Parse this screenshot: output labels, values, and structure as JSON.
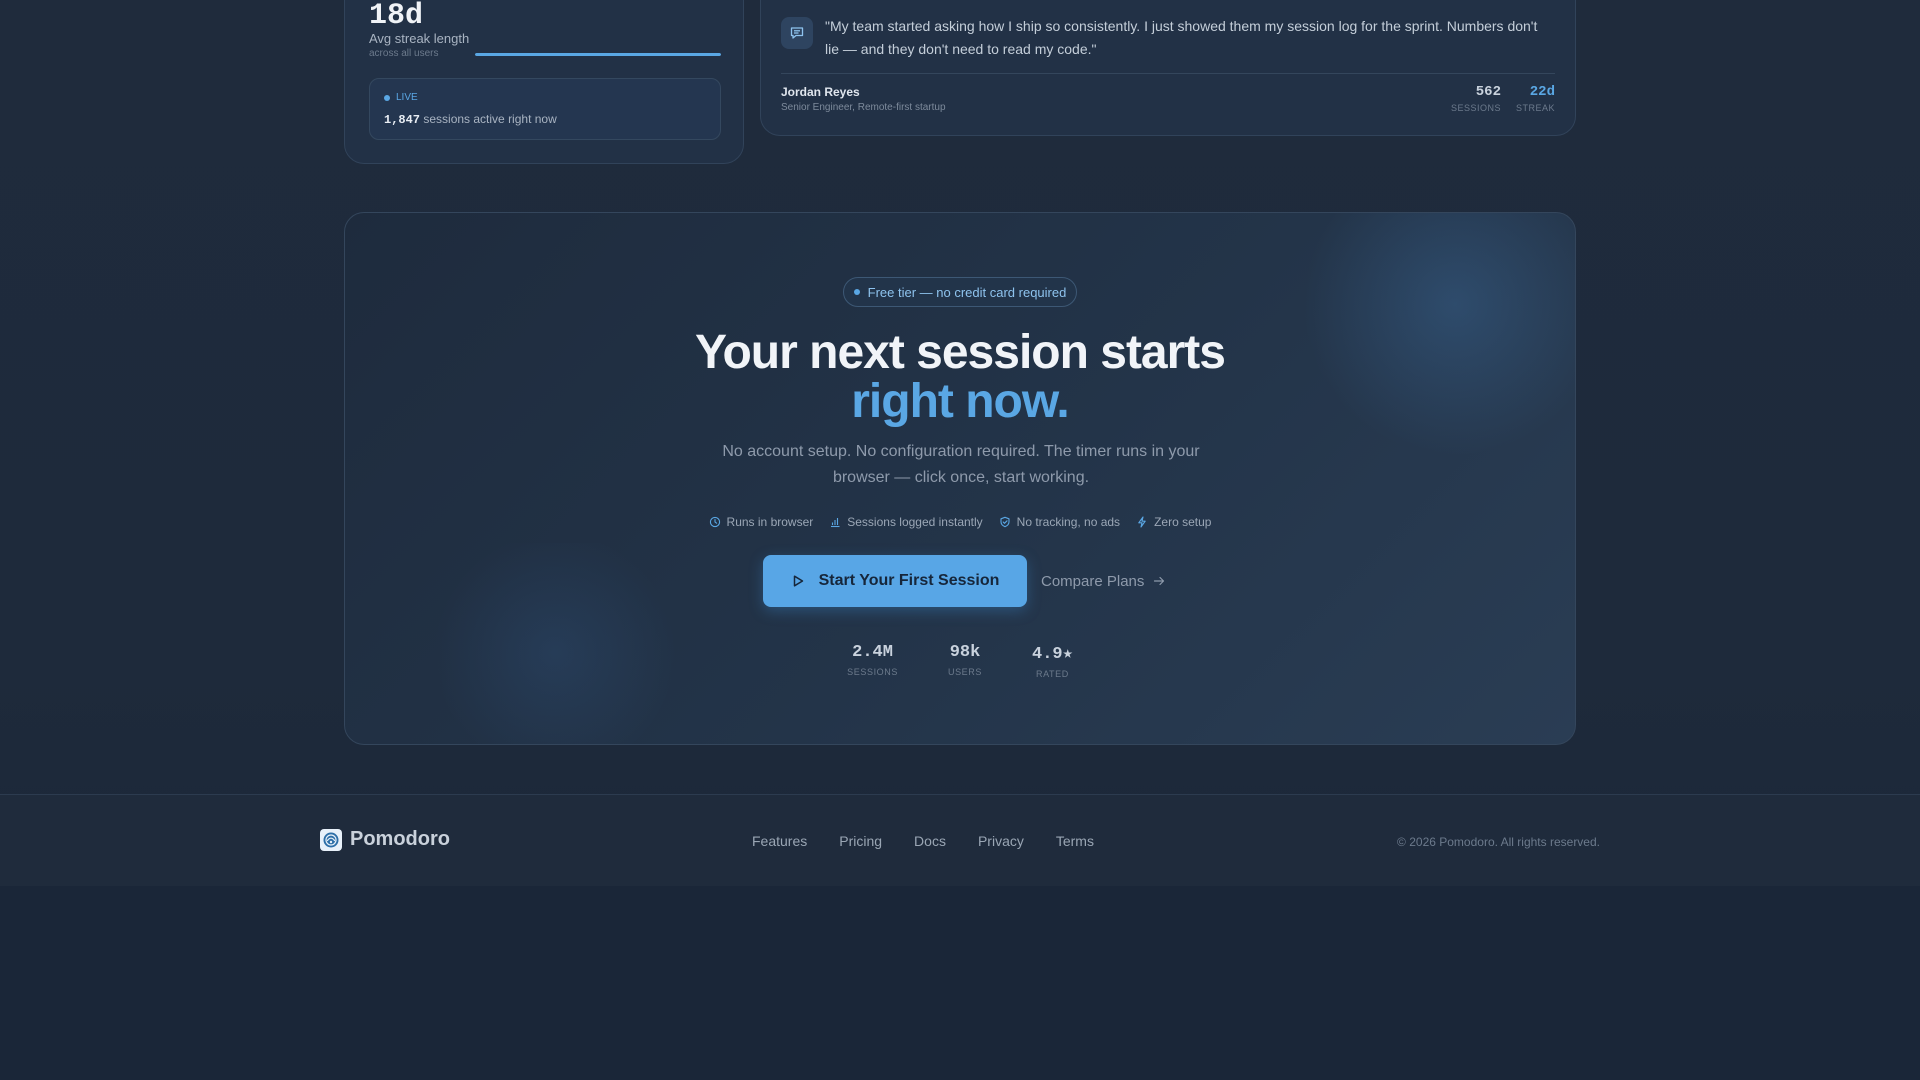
{
  "stat_card": {
    "value": "18d",
    "label": "Avg streak length",
    "sub_label": "across all users",
    "progress_fraction": 1.0,
    "live_label": "LIVE",
    "live_count": "1,847",
    "live_text": "sessions active right now"
  },
  "testimonial": {
    "icon": "chat-bubble-icon",
    "quote": "\"My team started asking how I ship so consistently. I just showed them my session log for the sprint. Numbers don't lie — and they don't need to read my code.\"",
    "name": "Jordan Reyes",
    "role": "Senior Engineer, Remote-first startup",
    "stats": [
      {
        "value": "562",
        "label": "SESSIONS"
      },
      {
        "value": "22d",
        "label": "STREAK"
      }
    ]
  },
  "cta": {
    "pill": "Free tier — no credit card required",
    "headline_line1": "Your next session starts",
    "headline_line2": "right now.",
    "subhead": "No account setup. No configuration required. The timer runs in your browser — click once, start working.",
    "features": [
      {
        "icon": "clock-icon",
        "label": "Runs in browser"
      },
      {
        "icon": "bar-chart-icon",
        "label": "Sessions logged instantly"
      },
      {
        "icon": "shield-icon",
        "label": "No tracking, no ads"
      },
      {
        "icon": "bolt-icon",
        "label": "Zero setup"
      }
    ],
    "primary_button": "Start Your First Session",
    "secondary_link": "Compare Plans",
    "stats": [
      {
        "value": "2.4M",
        "label": "SESSIONS"
      },
      {
        "value": "98k",
        "label": "USERS"
      },
      {
        "value": "4.9★",
        "label": "RATED"
      }
    ]
  },
  "footer": {
    "brand": "Pomodoro",
    "nav": [
      "Features",
      "Pricing",
      "Docs",
      "Privacy",
      "Terms"
    ],
    "copyright": "© 2026 Pomodoro. All rights reserved."
  },
  "colors": {
    "accent": "#5aa7e4",
    "background": "#1f2b3c",
    "card": "#223146"
  }
}
